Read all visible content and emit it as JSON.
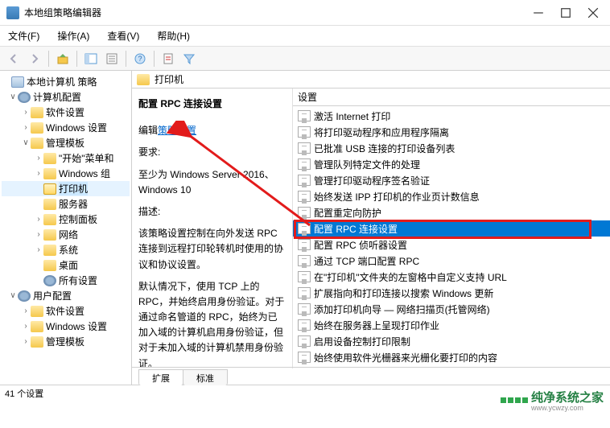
{
  "window": {
    "title": "本地组策略编辑器"
  },
  "menu": {
    "file": "文件(F)",
    "action": "操作(A)",
    "view": "查看(V)",
    "help": "帮助(H)"
  },
  "tree": {
    "root": "本地计算机 策略",
    "computer": "计算机配置",
    "software": "软件设置",
    "windows": "Windows 设置",
    "admin": "管理模板",
    "start": "\"开始\"菜单和",
    "wincomp": "Windows 组",
    "printer": "打印机",
    "server": "服务器",
    "ctrlpanel": "控制面板",
    "network": "网络",
    "system": "系统",
    "desktop": "桌面",
    "allsettings": "所有设置",
    "user": "用户配置",
    "usoftware": "软件设置",
    "uwindows": "Windows 设置",
    "uadmin": "管理模板"
  },
  "header": {
    "title": "打印机"
  },
  "info": {
    "policy_title": "配置 RPC 连接设置",
    "edit_prefix": "编辑",
    "edit_link": "策略设置",
    "req_label": "要求:",
    "req_text": "至少为 Windows Server 2016、Windows 10",
    "desc_label": "描述:",
    "desc_p1": "该策略设置控制在向外发送 RPC 连接到远程打印轮转机时使用的协议和协议设置。",
    "desc_p2": "默认情况下，使用 TCP 上的 RPC，并始终启用身份验证。对于通过命名管道的 RPC，始终为已加入域的计算机启用身份验证，但对于未加入域的计算机禁用身份验证。"
  },
  "list": {
    "header": "设置",
    "items": [
      "激活 Internet 打印",
      "将打印驱动程序和应用程序隔离",
      "已批准 USB 连接的打印设备列表",
      "管理队列特定文件的处理",
      "管理打印驱动程序签名验证",
      "始终发送 IPP 打印机的作业页计数信息",
      "配置重定向防护",
      "配置 RPC 连接设置",
      "配置 RPC 侦听器设置",
      "通过 TCP 端口配置 RPC",
      "在\"打印机\"文件夹的左窗格中自定义支持 URL",
      "扩展指向和打印连接以搜索 Windows 更新",
      "添加打印机向导 — 网络扫描页(托管网络)",
      "始终在服务器上呈现打印作业",
      "启用设备控制打印限制",
      "始终使用软件光栅器来光栅化要打印的内容"
    ],
    "selected": 7
  },
  "tabs": {
    "extended": "扩展",
    "standard": "标准"
  },
  "status": {
    "text": "41 个设置"
  },
  "watermark": {
    "name": "纯净系统之家",
    "url": "www.ycwzy.com"
  }
}
